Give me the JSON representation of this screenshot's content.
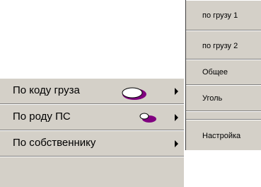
{
  "main_menu": {
    "items": [
      {
        "label": "По коду груза",
        "icon": "wagon-icon-large"
      },
      {
        "label": "По роду ПС",
        "icon": "wagon-icon-small"
      },
      {
        "label": "По собственнику"
      }
    ]
  },
  "submenu": {
    "items": [
      {
        "label": "по грузу 1"
      },
      {
        "label": "по грузу 2"
      },
      {
        "label": "Общее"
      },
      {
        "label": "Уголь"
      },
      {
        "label": "Настройка"
      }
    ]
  },
  "colors": {
    "menu_bg": "#d4d0c8",
    "icon_accent": "#800080"
  }
}
